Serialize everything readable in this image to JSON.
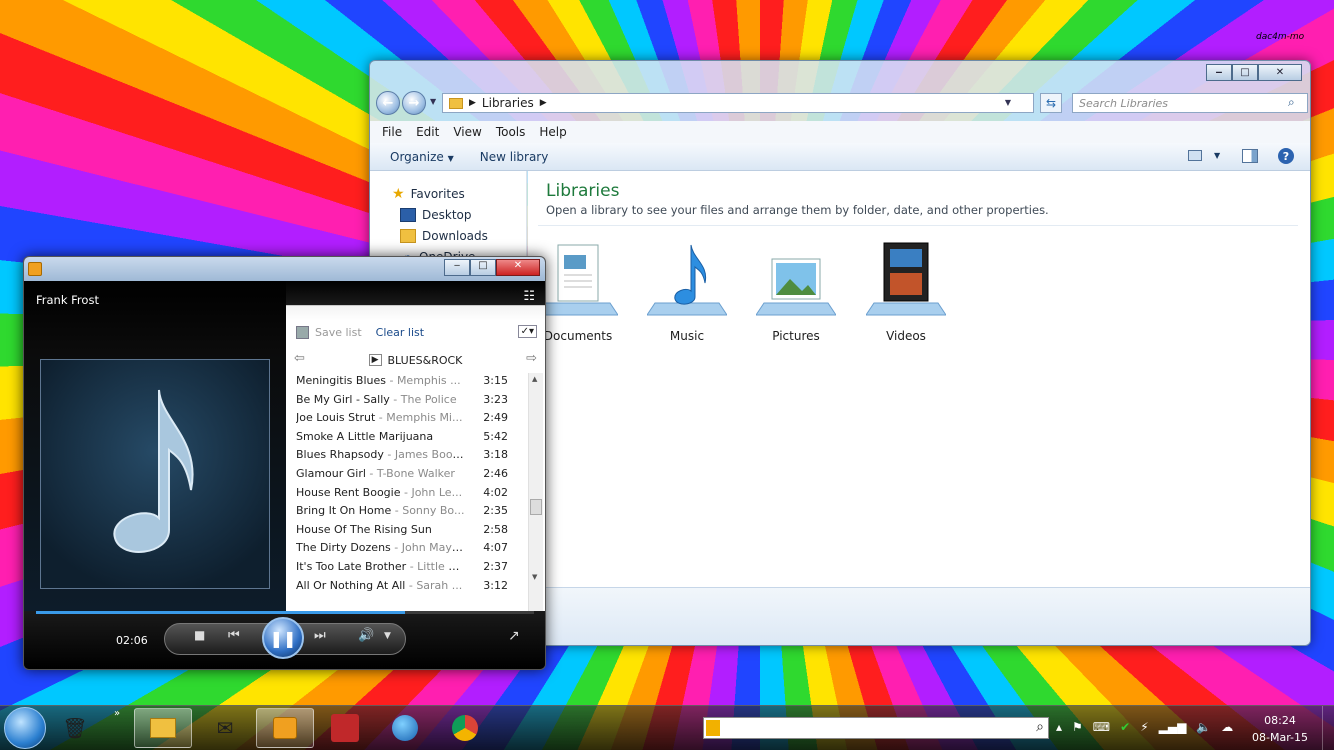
{
  "watermark": "dac4m-mo",
  "explorer": {
    "breadcrumb": "Libraries",
    "search_placeholder": "Search Libraries",
    "menu": [
      "File",
      "Edit",
      "View",
      "Tools",
      "Help"
    ],
    "commands": {
      "organize": "Organize",
      "new_library": "New library"
    },
    "nav": {
      "favorites": "Favorites",
      "items": [
        "Desktop",
        "Downloads",
        "OneDrive"
      ]
    },
    "title": "Libraries",
    "subtitle": "Open a library to see your files and arrange them by folder, date, and other properties.",
    "libraries": [
      "Documents",
      "Music",
      "Pictures",
      "Videos"
    ]
  },
  "player": {
    "artist": "Frank Frost",
    "save_list": "Save list",
    "clear_list": "Clear list",
    "playlist": "BLUES&ROCK",
    "tracks": [
      {
        "title": "Meningitis Blues",
        "artist": "Memphis ...",
        "duration": "3:15"
      },
      {
        "title": "Be My Girl - Sally",
        "artist": "The Police",
        "duration": "3:23"
      },
      {
        "title": "Joe Louis Strut",
        "artist": "Memphis Mi...",
        "duration": "2:49"
      },
      {
        "title": "Smoke A Little Marijuana",
        "artist": "",
        "duration": "5:42"
      },
      {
        "title": "Blues Rhapsody",
        "artist": "James Booker",
        "duration": "3:18"
      },
      {
        "title": "Glamour Girl",
        "artist": "T-Bone Walker",
        "duration": "2:46"
      },
      {
        "title": "House Rent Boogie",
        "artist": "John Le...",
        "duration": "4:02"
      },
      {
        "title": "Bring It On Home",
        "artist": "Sonny Bo...",
        "duration": "2:35"
      },
      {
        "title": "House Of The Rising Sun",
        "artist": "",
        "duration": "2:58"
      },
      {
        "title": "The Dirty Dozens",
        "artist": "John Maya...",
        "duration": "4:07"
      },
      {
        "title": "It's Too Late Brother",
        "artist": "Little W...",
        "duration": "2:37"
      },
      {
        "title": "All Or Nothing At All",
        "artist": "Sarah ...",
        "duration": "3:12"
      }
    ],
    "elapsed": "02:06",
    "progress": 0.74
  },
  "taskbar": {
    "time": "08:24",
    "date": "08-Mar-15"
  },
  "colors": {
    "accent": "#2f6fc4",
    "library_title": "#1e7a3c",
    "seek": "#3a9ae8"
  }
}
